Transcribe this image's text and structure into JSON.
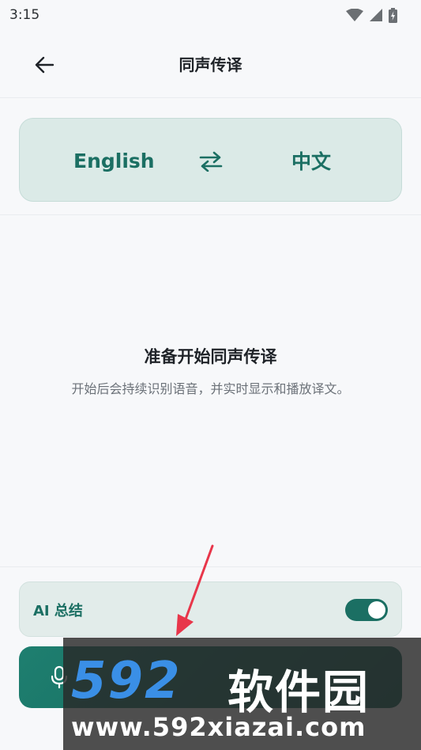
{
  "status_bar": {
    "time": "3:15",
    "icons": [
      "wifi-icon",
      "signal-icon",
      "battery-charging-icon"
    ]
  },
  "app_bar": {
    "back_icon": "arrow-left-icon",
    "title": "同声传译"
  },
  "language_selector": {
    "source": "English",
    "target": "中文",
    "swap_icon": "swap-horizontal-icon"
  },
  "empty_state": {
    "title": "准备开始同声传译",
    "description": "开始后会持续识别语音，并实时显示和播放译文。"
  },
  "ai_summary": {
    "label": "AI 总结",
    "enabled": true
  },
  "start_button": {
    "icon": "microphone-icon"
  },
  "watermark": {
    "logo_number": "592",
    "logo_text": "软件园",
    "url": "www.592xiazai.com"
  },
  "colors": {
    "accent": "#1b6f63",
    "card_bg": "#dbeae7",
    "background": "#f7f8fa",
    "arrow": "#e8364a"
  }
}
